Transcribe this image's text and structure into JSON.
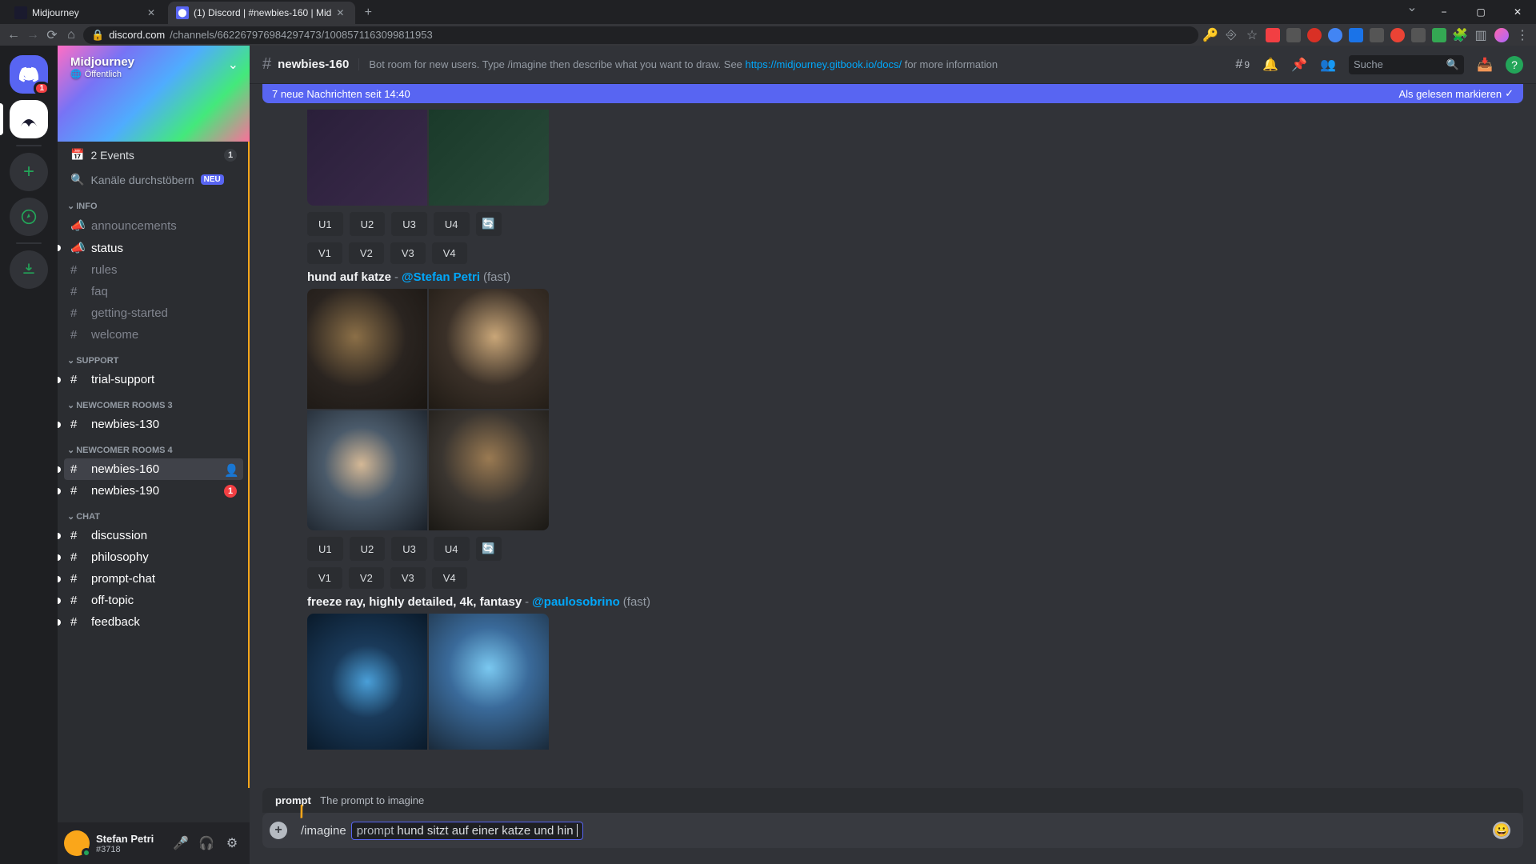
{
  "browser": {
    "tabs": [
      {
        "title": "Midjourney",
        "favicon_bg": "#1a1a2e",
        "active": false
      },
      {
        "title": "(1) Discord | #newbies-160 | Mid",
        "favicon_bg": "#5865f2",
        "active": true
      }
    ],
    "url_host": "discord.com",
    "url_path": "/channels/662267976984297473/1008571163099811953",
    "window_controls": {
      "min": "−",
      "max": "▢",
      "close": "✕"
    }
  },
  "server": {
    "name": "Midjourney",
    "public_label": "Öffentlich"
  },
  "sidebar": {
    "events_label": "2 Events",
    "events_badge": "1",
    "browse_label": "Kanäle durchstöbern",
    "neu_label": "NEU",
    "categories": [
      {
        "name": "INFO",
        "channels": [
          {
            "icon": "megaphone",
            "label": "announcements",
            "unread": false
          },
          {
            "icon": "megaphone",
            "label": "status",
            "unread": true
          },
          {
            "icon": "hash",
            "label": "rules",
            "unread": false
          },
          {
            "icon": "hash",
            "label": "faq",
            "unread": false
          },
          {
            "icon": "hash",
            "label": "getting-started",
            "unread": false
          },
          {
            "icon": "hash",
            "label": "welcome",
            "unread": false
          }
        ]
      },
      {
        "name": "SUPPORT",
        "channels": [
          {
            "icon": "hash",
            "label": "trial-support",
            "unread": true
          }
        ]
      },
      {
        "name": "NEWCOMER ROOMS 3",
        "channels": [
          {
            "icon": "hash",
            "label": "newbies-130",
            "unread": true
          }
        ]
      },
      {
        "name": "NEWCOMER ROOMS 4",
        "channels": [
          {
            "icon": "hash",
            "label": "newbies-160",
            "unread": true,
            "selected": true
          },
          {
            "icon": "hash",
            "label": "newbies-190",
            "unread": true,
            "mention": "1"
          }
        ]
      },
      {
        "name": "CHAT",
        "channels": [
          {
            "icon": "hash",
            "label": "discussion",
            "unread": true
          },
          {
            "icon": "hash",
            "label": "philosophy",
            "unread": true
          },
          {
            "icon": "hash",
            "label": "prompt-chat",
            "unread": true
          },
          {
            "icon": "hash",
            "label": "off-topic",
            "unread": true
          },
          {
            "icon": "hash",
            "label": "feedback",
            "unread": true
          }
        ]
      }
    ]
  },
  "user_panel": {
    "name": "Stefan Petri",
    "tag": "#3718"
  },
  "chat_header": {
    "channel": "newbies-160",
    "topic_prefix": "Bot room for new users. Type /imagine then describe what you want to draw. See ",
    "topic_link": "https://midjourney.gitbook.io/docs/",
    "topic_suffix": " for more information",
    "threads_count": "9",
    "search_placeholder": "Suche"
  },
  "new_messages": {
    "text": "7 neue Nachrichten seit 14:40",
    "mark_read": "Als gelesen markieren"
  },
  "messages": {
    "grid1": {
      "u": [
        "U1",
        "U2",
        "U3",
        "U4"
      ],
      "v": [
        "V1",
        "V2",
        "V3",
        "V4"
      ]
    },
    "msg2": {
      "prompt": "hund auf katze",
      "sep": " - ",
      "user": "@Stefan Petri",
      "suffix": " (fast)",
      "u": [
        "U1",
        "U2",
        "U3",
        "U4"
      ],
      "v": [
        "V1",
        "V2",
        "V3",
        "V4"
      ]
    },
    "msg3": {
      "prompt": "freeze ray, highly detailed, 4k, fantasy",
      "sep": " - ",
      "user": "@paulosobrino",
      "suffix": " (fast)"
    }
  },
  "autocomplete": {
    "label": "prompt",
    "desc": "The prompt to imagine"
  },
  "input": {
    "command": "/imagine",
    "param_label": "prompt",
    "param_value": "hund sitzt auf einer katze und hin"
  }
}
